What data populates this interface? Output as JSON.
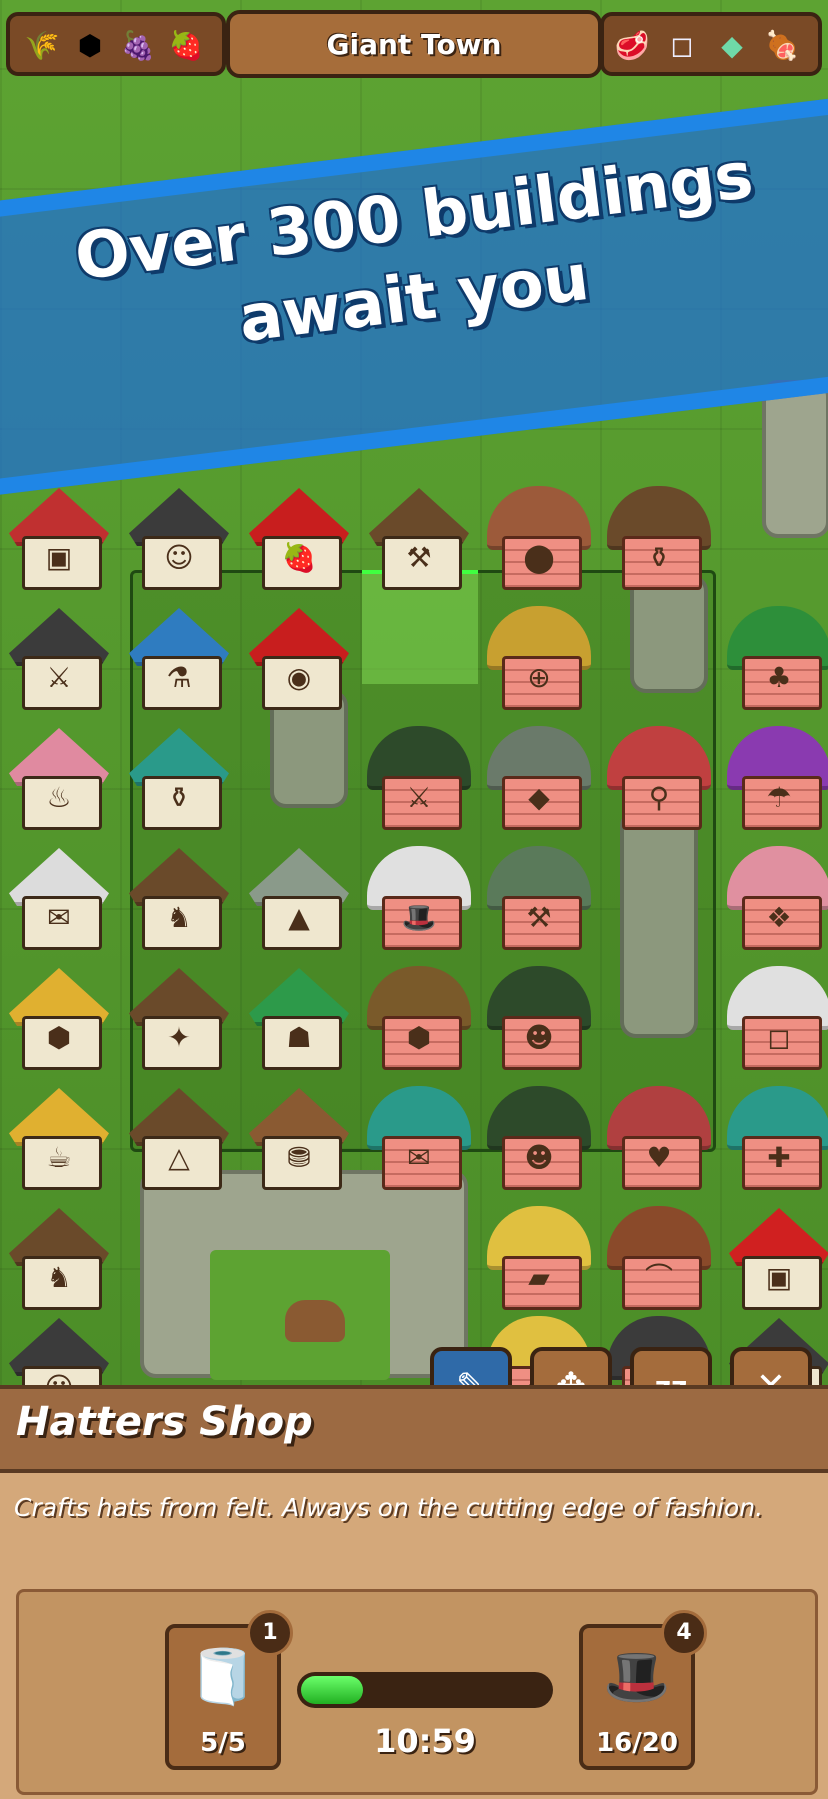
{
  "header": {
    "town_name": "Giant Town",
    "resources_left": [
      {
        "icon": "wheat-icon",
        "glyph": "🌾"
      },
      {
        "icon": "honeycomb-icon",
        "glyph": "⬢"
      },
      {
        "icon": "grapes-icon",
        "glyph": "🍇"
      },
      {
        "icon": "strawberry-icon",
        "glyph": "🍓"
      }
    ],
    "resources_right": [
      {
        "icon": "meat-icon",
        "glyph": "🥩"
      },
      {
        "icon": "sugar-cube-icon",
        "glyph": "◻"
      },
      {
        "icon": "gems-icon",
        "glyph": "◆"
      },
      {
        "icon": "ham-icon",
        "glyph": "🍖"
      }
    ]
  },
  "banner": {
    "line1": "Over 300 buildings",
    "line2": "await you"
  },
  "selected_building": {
    "name": "Hatters Shop",
    "description": "Crafts hats from felt. Always on the cutting edge of fashion."
  },
  "production": {
    "input": {
      "icon": "felt-roll-icon",
      "glyph": "🧻",
      "level": "1",
      "count": "5/5"
    },
    "output": {
      "icon": "top-hat-icon",
      "glyph": "🎩",
      "level": "4",
      "count": "16/20"
    },
    "timer": "10:59",
    "progress": 0.25
  },
  "actions": {
    "pick_glyph": "✎",
    "move_glyph": "✥",
    "sleep_glyph": "zz",
    "close_glyph": "✕"
  }
}
